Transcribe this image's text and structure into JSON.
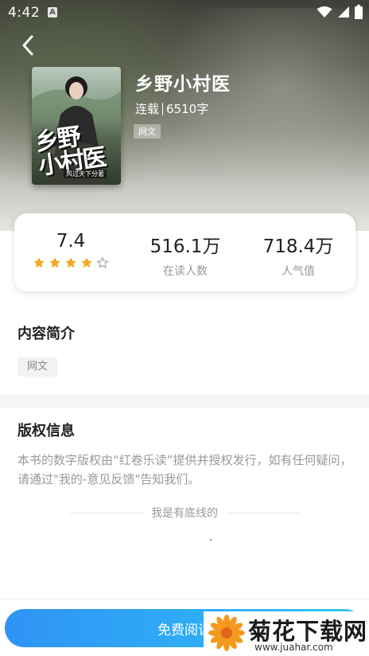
{
  "status_bar": {
    "time": "4:42",
    "notification_letter": "A",
    "icons": [
      "wifi-icon",
      "signal-icon",
      "battery-icon"
    ]
  },
  "header": {
    "back_icon": "chevron-left-icon"
  },
  "book": {
    "title": "乡野小村医",
    "status": "连载",
    "word_count": "6510字",
    "category_tag": "网文",
    "cover_title": "乡野\n小村医",
    "cover_subtitle": "风过天下分著"
  },
  "stats": {
    "rating": "7.4",
    "rating_stars": 4,
    "rating_max": 5,
    "readers_value": "516.1万",
    "readers_label": "在读人数",
    "popularity_value": "718.4万",
    "popularity_label": "人气值",
    "star_color": "#f5a623"
  },
  "intro": {
    "title": "内容简介",
    "tag": "网文"
  },
  "copyright": {
    "title": "版权信息",
    "text": "本书的数字版权由“红卷乐读”提供并授权发行，如有任何疑问，请通过\"我的-意见反馈\"告知我们。"
  },
  "footer_note": "我是有底线的",
  "bottom_bar": {
    "read_button": "免费阅读",
    "button_color": "#2f9cf5"
  },
  "watermark": {
    "name": "菊花下载网",
    "url": "www.juahar.com"
  }
}
